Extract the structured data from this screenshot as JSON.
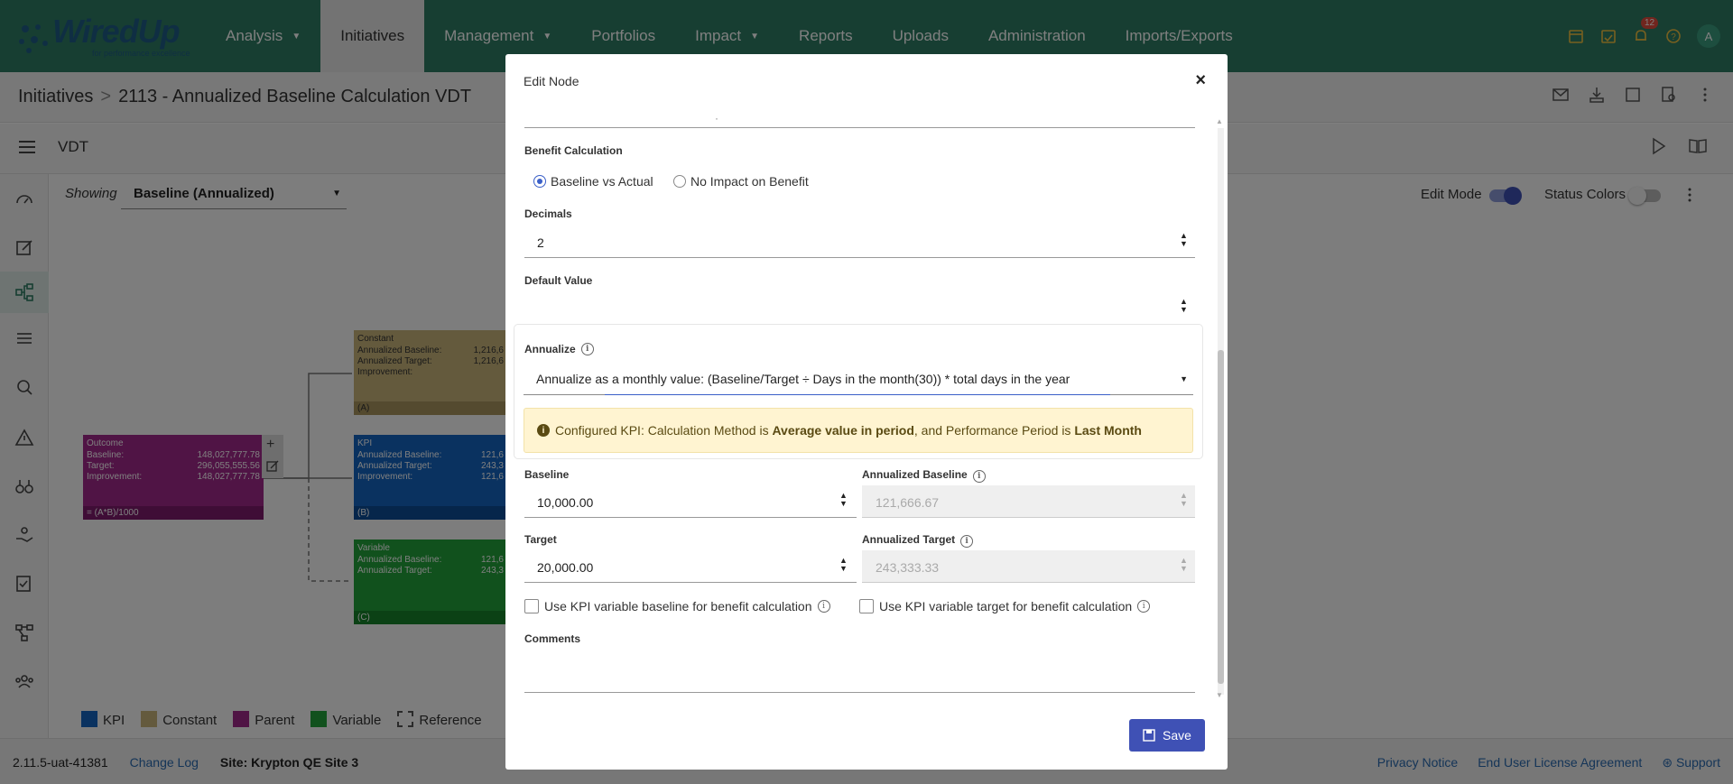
{
  "logo": {
    "text": "WiredUp",
    "tagline": "for performance excellence"
  },
  "nav": {
    "items": [
      {
        "label": "Analysis",
        "dropdown": true
      },
      {
        "label": "Initiatives",
        "dropdown": false,
        "active": true
      },
      {
        "label": "Management",
        "dropdown": true
      },
      {
        "label": "Portfolios",
        "dropdown": false
      },
      {
        "label": "Impact",
        "dropdown": true
      },
      {
        "label": "Reports",
        "dropdown": false
      },
      {
        "label": "Uploads",
        "dropdown": false
      },
      {
        "label": "Administration",
        "dropdown": false
      },
      {
        "label": "Imports/Exports",
        "dropdown": false
      }
    ],
    "notification_count": "12",
    "avatar_initial": "A",
    "caret": "▼"
  },
  "breadcrumb": {
    "root": "Initiatives",
    "separator": ">",
    "current": "2113 - Annualized Baseline Calculation VDT"
  },
  "vdt": {
    "title": "VDT",
    "showing_label": "Showing",
    "showing_value": "Baseline (Annualized)",
    "edit_mode_label": "Edit Mode",
    "status_colors_label": "Status Colors"
  },
  "nodes": {
    "constant": {
      "type": "Constant",
      "rows": [
        [
          "Annualized Baseline:",
          "1,216,6"
        ],
        [
          "Annualized Target:",
          "1,216,6"
        ],
        [
          "Improvement:",
          ""
        ]
      ],
      "ref": "(A)"
    },
    "kpi": {
      "type": "KPI",
      "rows": [
        [
          "Annualized Baseline:",
          "121,6"
        ],
        [
          "Annualized Target:",
          "243,3"
        ],
        [
          "Improvement:",
          "121,6"
        ]
      ],
      "ref": "(B)"
    },
    "variable": {
      "type": "Variable",
      "rows": [
        [
          "Annualized Baseline:",
          "121,6"
        ],
        [
          "Annualized Target:",
          "243,3"
        ]
      ],
      "ref": "(C)"
    },
    "outcome": {
      "type": "Outcome",
      "rows": [
        [
          "Baseline:",
          "148,027,777.78"
        ],
        [
          "Target:",
          "296,055,555.56"
        ],
        [
          "Improvement:",
          "148,027,777.78"
        ]
      ],
      "formula": "= (A*B)/1000"
    }
  },
  "legend": [
    {
      "label": "KPI",
      "color": "#1565c0"
    },
    {
      "label": "Constant",
      "color": "#c8b47a"
    },
    {
      "label": "Parent",
      "color": "#a0288a"
    },
    {
      "label": "Variable",
      "color": "#22a33a"
    },
    {
      "label": "Reference",
      "color": "dashed"
    }
  ],
  "footer": {
    "version": "2.11.5-uat-41381",
    "changelog": "Change Log",
    "site": "Site: Krypton QE Site 3",
    "privacy": "Privacy Notice",
    "eula": "End User License Agreement",
    "support": "Support"
  },
  "modal": {
    "title": "Edit Node",
    "close": "×",
    "partial_field_value": "·",
    "benefit_calc": {
      "label": "Benefit Calculation",
      "options": [
        "Baseline vs Actual",
        "No Impact on Benefit"
      ],
      "selected": "Baseline vs Actual"
    },
    "decimals": {
      "label": "Decimals",
      "value": "2"
    },
    "default_value": {
      "label": "Default Value",
      "value": ""
    },
    "annualize": {
      "label": "Annualize",
      "value": "Annualize as a monthly value: (Baseline/Target ÷ Days in the month(30)) * total days in the year",
      "warning_prefix": "Configured KPI: Calculation Method is ",
      "warning_method": "Average value in period",
      "warning_mid": ", and Performance Period is ",
      "warning_period": "Last Month"
    },
    "baseline": {
      "label": "Baseline",
      "value": "10,000.00"
    },
    "annualized_baseline": {
      "label": "Annualized Baseline",
      "value": "121,666.67"
    },
    "target": {
      "label": "Target",
      "value": "20,000.00"
    },
    "annualized_target": {
      "label": "Annualized Target",
      "value": "243,333.33"
    },
    "use_kpi_baseline": "Use KPI variable baseline for benefit calculation",
    "use_kpi_target": "Use KPI variable target for benefit calculation",
    "comments": {
      "label": "Comments",
      "value": ""
    },
    "save": "Save"
  }
}
